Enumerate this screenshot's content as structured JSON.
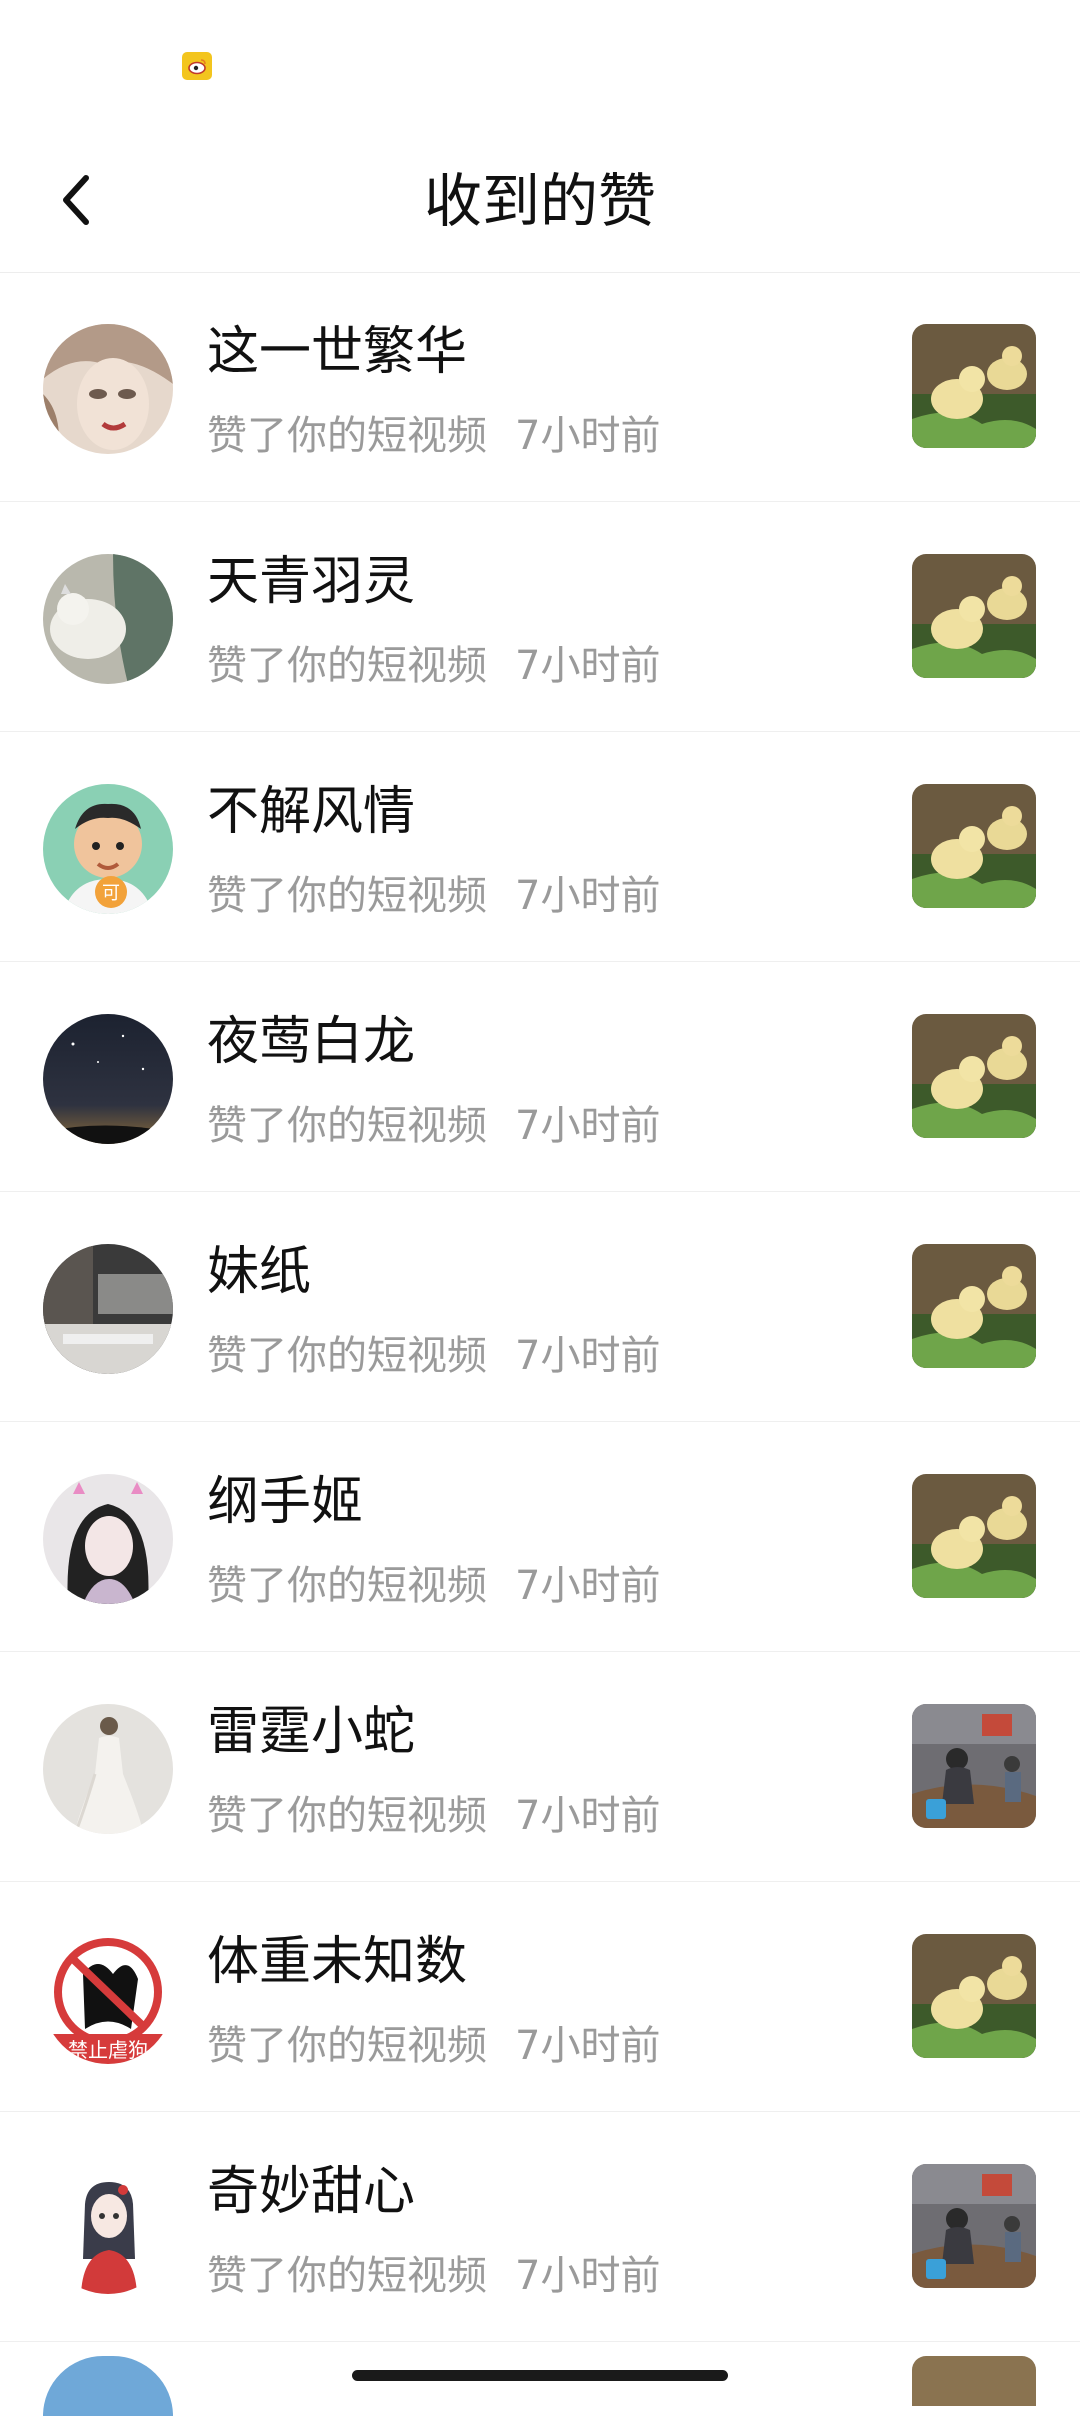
{
  "status_bar": {
    "icon": "weibo-icon"
  },
  "header": {
    "title": "收到的赞",
    "back_icon": "chevron-left-icon"
  },
  "list": {
    "items": [
      {
        "name": "这一世繁华",
        "action": "赞了你的短视频",
        "time": "7小时前",
        "avatar": "avatar-illustrated-woman",
        "thumb": "ducklings"
      },
      {
        "name": "天青羽灵",
        "action": "赞了你的短视频",
        "time": "7小时前",
        "avatar": "avatar-white-cat",
        "thumb": "ducklings"
      },
      {
        "name": "不解风情",
        "action": "赞了你的短视频",
        "time": "7小时前",
        "avatar": "avatar-cartoon-boy",
        "thumb": "ducklings"
      },
      {
        "name": "夜莺白龙",
        "action": "赞了你的短视频",
        "time": "7小时前",
        "avatar": "avatar-night-sky",
        "thumb": "ducklings"
      },
      {
        "name": "妹纸",
        "action": "赞了你的短视频",
        "time": "7小时前",
        "avatar": "avatar-kitchen",
        "thumb": "ducklings"
      },
      {
        "name": "纲手姬",
        "action": "赞了你的短视频",
        "time": "7小时前",
        "avatar": "avatar-girl-portrait",
        "thumb": "ducklings"
      },
      {
        "name": "雷霆小蛇",
        "action": "赞了你的短视频",
        "time": "7小时前",
        "avatar": "avatar-wedding-dress",
        "thumb": "market-scene"
      },
      {
        "name": "体重未知数",
        "action": "赞了你的短视频",
        "time": "7小时前",
        "avatar": "avatar-no-dog-abuse-sign",
        "avatar_text": "禁止虐狗",
        "thumb": "ducklings"
      },
      {
        "name": "奇妙甜心",
        "action": "赞了你的短视频",
        "time": "7小时前",
        "avatar": "avatar-anime-girl",
        "thumb": "market-scene"
      }
    ]
  },
  "colors": {
    "text_primary": "#111111",
    "text_secondary": "#9a9a9a",
    "divider": "#efefef",
    "weibo_yellow": "#f3c51e",
    "badge_orange": "#f2a23a"
  }
}
